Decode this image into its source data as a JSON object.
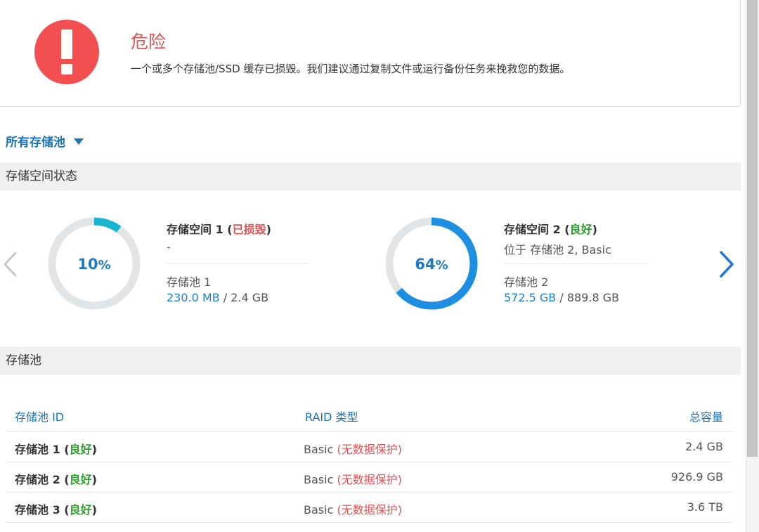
{
  "alert": {
    "title": "危险",
    "message": "一个或多个存储池/SSD 缓存已损毁。我们建议通过复制文件或运行备份任务来挽救您的数据。"
  },
  "filter": {
    "label": "所有存储池"
  },
  "sections": {
    "volume_status": "存储空间状态",
    "pools": "存储池"
  },
  "volumes": [
    {
      "name": "存储空间 1",
      "status": "已损毁",
      "location": "-",
      "pool": "存储池 1",
      "used": "230.0 MB",
      "total": "2.4 GB",
      "percent_label": "10",
      "usage_fraction": 0.1,
      "color": "#18b4d0"
    },
    {
      "name": "存储空间 2",
      "status": "良好",
      "location": "位于 存储池 2, Basic",
      "pool": "存储池 2",
      "used": "572.5 GB",
      "total": "889.8 GB",
      "percent_label": "64",
      "usage_fraction": 0.64,
      "color": "#1e8ee0"
    }
  ],
  "pools_table": {
    "columns": [
      "存储池 ID",
      "RAID 类型",
      "总容量"
    ],
    "rows": [
      {
        "name": "存储池 1",
        "status": "良好",
        "raid": "Basic",
        "protection": "(无数据保护)",
        "capacity": "2.4 GB"
      },
      {
        "name": "存储池 2",
        "status": "良好",
        "raid": "Basic",
        "protection": "(无数据保护)",
        "capacity": "926.9 GB"
      },
      {
        "name": "存储池 3",
        "status": "良好",
        "raid": "Basic",
        "protection": "(无数据保护)",
        "capacity": "3.6 TB"
      }
    ]
  },
  "icons": {
    "alert": "exclamation-icon",
    "filter": "caret-down-icon",
    "prev": "chevron-left-icon",
    "next": "chevron-right-icon"
  },
  "colors": {
    "danger": "#f25050",
    "accent": "#1a73b5",
    "good": "#2e9c2e",
    "bad": "#e05252"
  }
}
